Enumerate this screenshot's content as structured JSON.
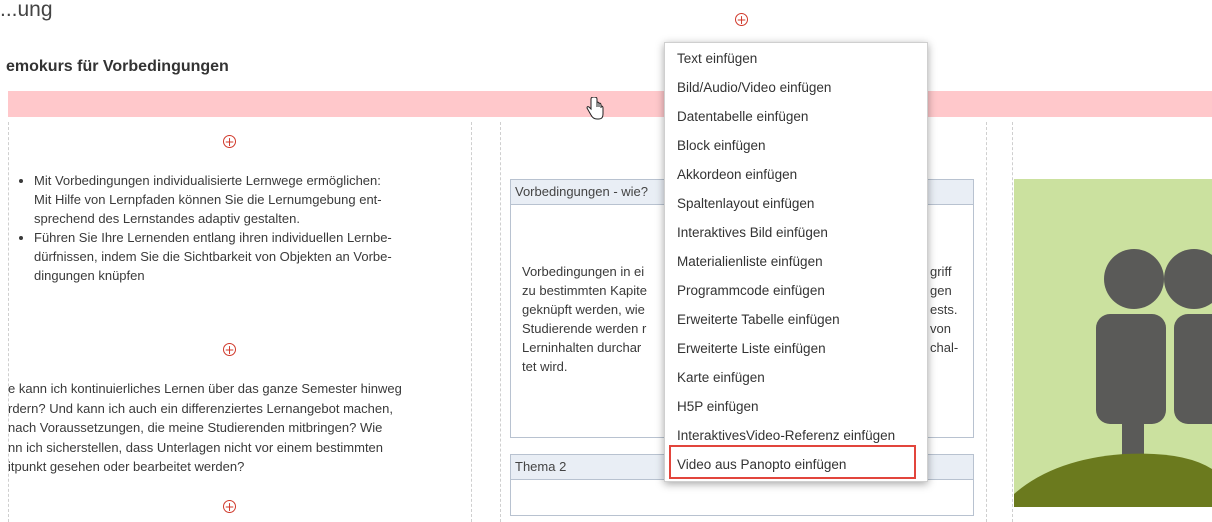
{
  "header": {
    "top_word": "...ung",
    "page_title": "emokurs für Vorbedingungen"
  },
  "left_column": {
    "bullets": [
      "Mit Vorbedingungen individualisierte Lernwege ermöglichen:\nMit Hilfe von Lernpfaden können Sie die Lernumgebung ent-\nsprechend des Lernstandes adaptiv gestalten.",
      "Führen Sie Ihre Lernenden entlang ihren individuellen Lernbe-\ndürfnissen, indem Sie die Sichtbarkeit von Objekten an Vorbe-\ndingungen knüpfen"
    ],
    "paragraph": "e kann ich kontinuierliches Lernen über das ganze Semester hinweg\nrdern? Und kann ich auch ein differenziertes Lernangebot machen,\nnach Voraussetzungen, die meine Studierenden mitbringen? Wie\nnn ich sicherstellen, dass Unterlagen nicht vor einem bestimmten\nitpunkt gesehen oder bearbeitet werden?"
  },
  "middle_column": {
    "block1_title": "Vorbedingungen - wie?",
    "block1_text_left": "Vorbedingungen in ei\nzu bestimmten Kapite\ngeknüpft werden, wie\nStudierende werden r\nLerninhalten durchar\ntet wird.",
    "block1_text_right": "griff\ngen\nests.\nvon\nchal-",
    "block2_title": "Thema 2"
  },
  "menu": {
    "items": [
      "Text einfügen",
      "Bild/Audio/Video einfügen",
      "Datentabelle einfügen",
      "Block einfügen",
      "Akkordeon einfügen",
      "Spaltenlayout einfügen",
      "Interaktives Bild einfügen",
      "Materialienliste einfügen",
      "Programmcode einfügen",
      "Erweiterte Tabelle einfügen",
      "Erweiterte Liste einfügen",
      "Karte einfügen",
      "H5P einfügen",
      "InteraktivesVideo-Referenz einfügen",
      "Video aus Panopto einfügen"
    ],
    "highlighted_item": "Video aus Panopto einfügen"
  },
  "icons": {
    "add": "plus-circle-icon",
    "cursor": "hand-pointer-icon",
    "people": "people-illustration-icon"
  },
  "colors": {
    "accent_red": "#d0392b",
    "highlight_red": "#e2453c",
    "pink_band": "#ffc8cb",
    "green_panel": "#cbe19f",
    "figure_dark": "#5a5a58",
    "figure_olive": "#6b7a1e"
  }
}
